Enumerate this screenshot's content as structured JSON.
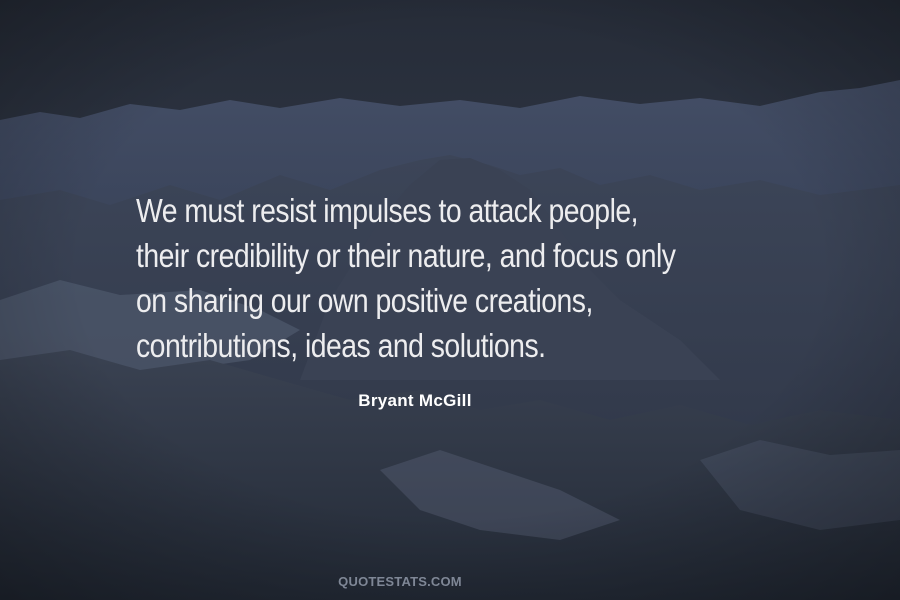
{
  "quote": {
    "lines": [
      "We must resist impulses to attack people,",
      "their credibility or their nature, and focus only",
      "on sharing our own positive creations,",
      "contributions, ideas and solutions."
    ]
  },
  "author": "Bryant McGill",
  "watermark": "QUOTESTATS.COM",
  "colors": {
    "text": "#ededef",
    "author": "#ffffff",
    "watermark": "#7f8796",
    "background": "#2f3747"
  }
}
